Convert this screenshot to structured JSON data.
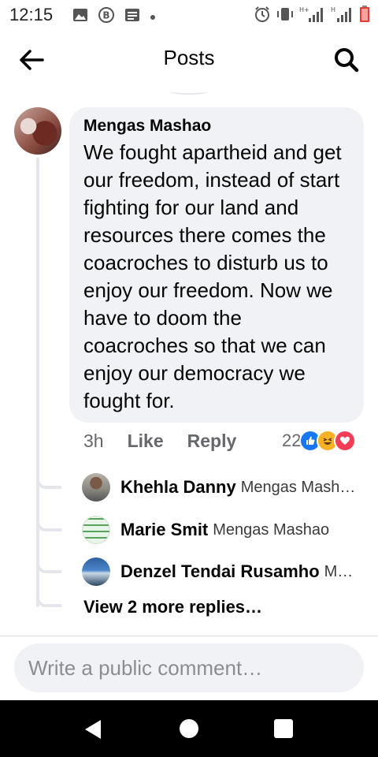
{
  "status_bar": {
    "time": "12:15",
    "left_icons": [
      "image-icon",
      "b-circle-icon",
      "news-icon",
      "dot-icon"
    ],
    "right_icons": [
      "alarm-icon",
      "vibrate-icon",
      "signal-h-plus-icon",
      "signal-h-icon",
      "battery-low-icon"
    ],
    "network_1": "H+",
    "network_2": "H",
    "battery_color": "#e53935"
  },
  "header": {
    "title": "Posts",
    "back_icon": "arrow-left-icon",
    "search_icon": "search-icon"
  },
  "comment": {
    "author": "Mengas Mashao",
    "text": "We fought apartheid and get our freedom, instead of start fighting for our land and resources there comes the coacroches to disturb us to enjoy our freedom. Now we have to doom the coacroches so that we can enjoy our democracy we fought for.",
    "time_ago": "3h",
    "like_label": "Like",
    "reply_label": "Reply",
    "reaction_count": "22",
    "reactions": [
      "like",
      "haha",
      "love"
    ]
  },
  "replies": [
    {
      "name": "Khehla Danny",
      "snippet": "Mengas Mash…"
    },
    {
      "name": "Marie Smit",
      "snippet": "Mengas Mashao"
    },
    {
      "name": "Denzel Tendai Rusamho",
      "snippet": "M…"
    }
  ],
  "view_more_label": "View 2 more replies…",
  "composer": {
    "placeholder": "Write a public comment…"
  },
  "colors": {
    "bubble_bg": "#f0f2f5",
    "secondary_text": "#65676b",
    "like_blue": "#1877f2",
    "haha_yellow": "#f7b125",
    "love_red": "#f33e58"
  }
}
